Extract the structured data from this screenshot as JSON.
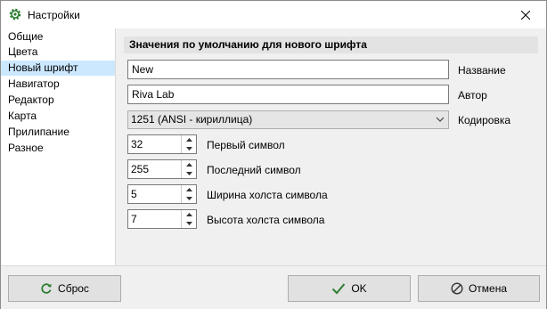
{
  "window": {
    "title": "Настройки"
  },
  "sidebar": {
    "items": [
      {
        "label": "Общие"
      },
      {
        "label": "Цвета"
      },
      {
        "label": "Новый шрифт"
      },
      {
        "label": "Навигатор"
      },
      {
        "label": "Редактор"
      },
      {
        "label": "Карта"
      },
      {
        "label": "Прилипание"
      },
      {
        "label": "Разное"
      }
    ],
    "selected": "Новый шрифт"
  },
  "section": {
    "title": "Значения по умолчанию для нового шрифта"
  },
  "fields": {
    "name": {
      "value": "New",
      "label": "Название"
    },
    "author": {
      "value": "Riva Lab",
      "label": "Автор"
    },
    "encoding": {
      "value": "1251 (ANSI - кириллица)",
      "label": "Кодировка"
    },
    "first_char": {
      "value": "32",
      "label": "Первый символ"
    },
    "last_char": {
      "value": "255",
      "label": "Последний символ"
    },
    "canvas_width": {
      "value": "5",
      "label": "Ширина холста символа"
    },
    "canvas_height": {
      "value": "7",
      "label": "Высота холста символа"
    }
  },
  "buttons": {
    "reset": "Сброс",
    "ok": "OK",
    "cancel": "Отмена"
  },
  "colors": {
    "selection": "#cce8ff",
    "ok_check": "#2e7d32",
    "reset_icon": "#2e7d32",
    "app_icon": "#2e7d32"
  }
}
